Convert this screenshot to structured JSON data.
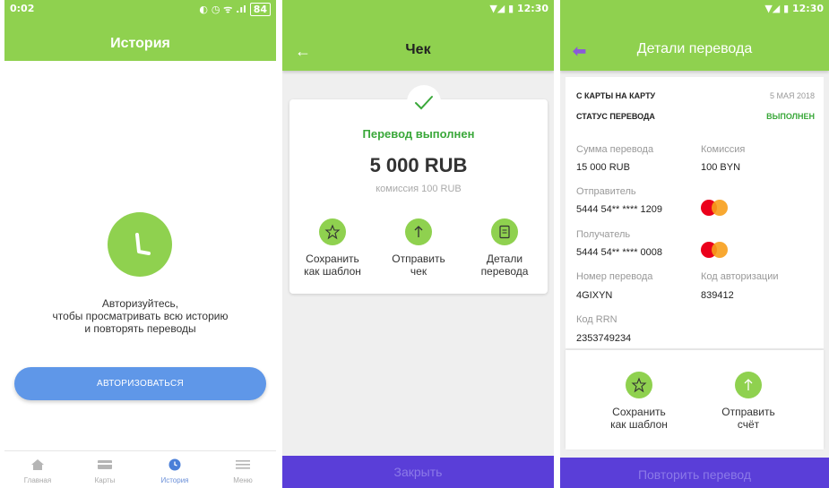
{
  "screen1": {
    "status": {
      "time": "0:02",
      "battery": "84"
    },
    "title": "История",
    "auth_text": [
      "Авторизуйтесь,",
      "чтобы просматривать всю историю",
      "и повторять переводы"
    ],
    "auth_button": "АВТОРИЗОВАТЬСЯ",
    "nav": [
      {
        "label": "Главная",
        "icon": "home-icon"
      },
      {
        "label": "Карты",
        "icon": "card-icon"
      },
      {
        "label": "История",
        "icon": "clock-icon",
        "active": true
      },
      {
        "label": "Меню",
        "icon": "menu-icon"
      }
    ]
  },
  "screen2": {
    "status": {
      "time": "12:30"
    },
    "title": "Чек",
    "status_text": "Перевод выполнен",
    "amount": "5 000 RUB",
    "fee": "комиссия 100 RUB",
    "actions": [
      {
        "line1": "Сохранить",
        "line2": "как шаблон"
      },
      {
        "line1": "Отправить",
        "line2": "чек"
      },
      {
        "line1": "Детали",
        "line2": "перевода"
      }
    ],
    "close_button": "Закрыть"
  },
  "screen3": {
    "status": {
      "time": "12:30"
    },
    "title": "Детали перевода",
    "type": "С КАРТЫ НА КАРТУ",
    "date": "5 МАЯ 2018",
    "status_label": "СТАТУС ПЕРЕВОДА",
    "status_value": "ВЫПОЛНЕН",
    "fields": {
      "amount_label": "Сумма перевода",
      "amount": "15 000 RUB",
      "commission_label": "Комиссия",
      "commission": "100 BYN",
      "sender_label": "Отправитель",
      "sender": "5444 54** **** 1209",
      "recipient_label": "Получатель",
      "recipient": "5444 54** **** 0008",
      "transfer_no_label": "Номер перевода",
      "transfer_no": "4GIXYN",
      "auth_code_label": "Код авторизации",
      "auth_code": "839412",
      "rrn_label": "Код RRN",
      "rrn": "2353749234"
    },
    "actions": [
      {
        "line1": "Сохранить",
        "line2": "как шаблон"
      },
      {
        "line1": "Отправить",
        "line2": "счёт"
      }
    ],
    "repeat_button": "Повторить перевод"
  },
  "colors": {
    "accent_green": "#8fd14f",
    "status_green": "#3aa83a",
    "primary_blue": "#5f97e8",
    "footer_purple": "#5a3ed8"
  }
}
